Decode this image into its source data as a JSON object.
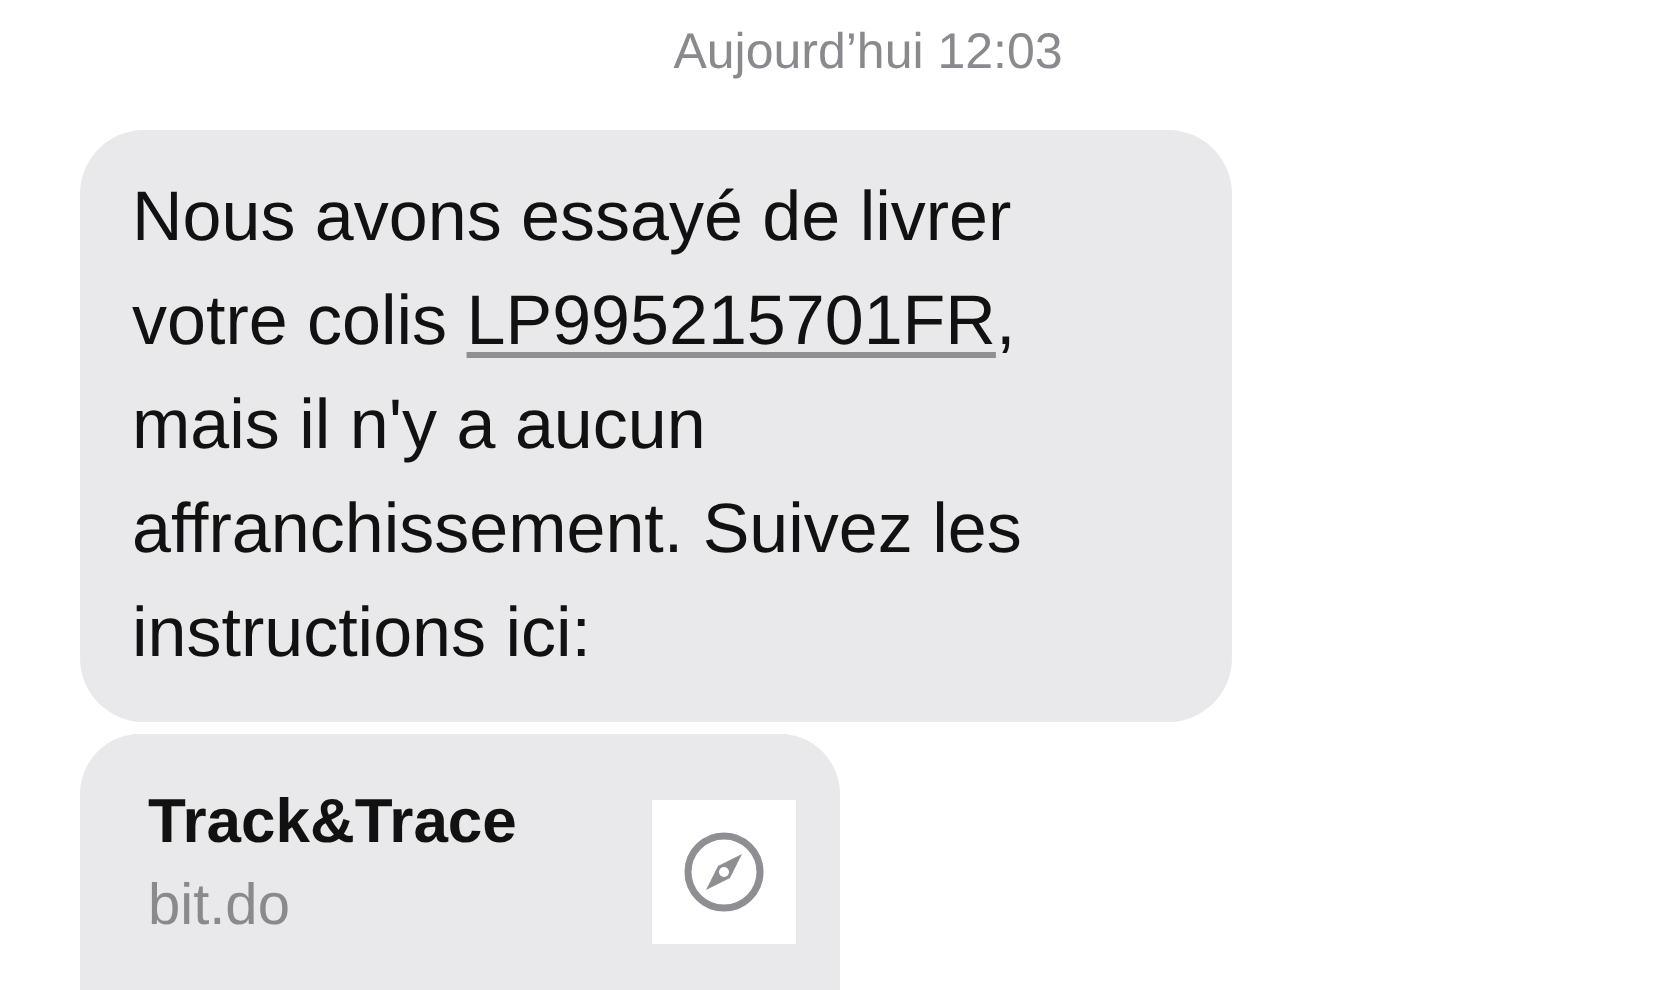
{
  "timestamp": "Aujourd’hui 12:03",
  "message": {
    "body": [
      {
        "kind": "text",
        "text": "Nous avons essayé de livrer\nvotre colis "
      },
      {
        "kind": "link",
        "text": "LP995215701FR"
      },
      {
        "kind": "text",
        "text": ",\nmais il n'y a aucun\naffranchissement. Suivez les\ninstructions ici:"
      }
    ]
  },
  "link_preview": {
    "title": "Track&Trace",
    "domain": "bit.do"
  }
}
